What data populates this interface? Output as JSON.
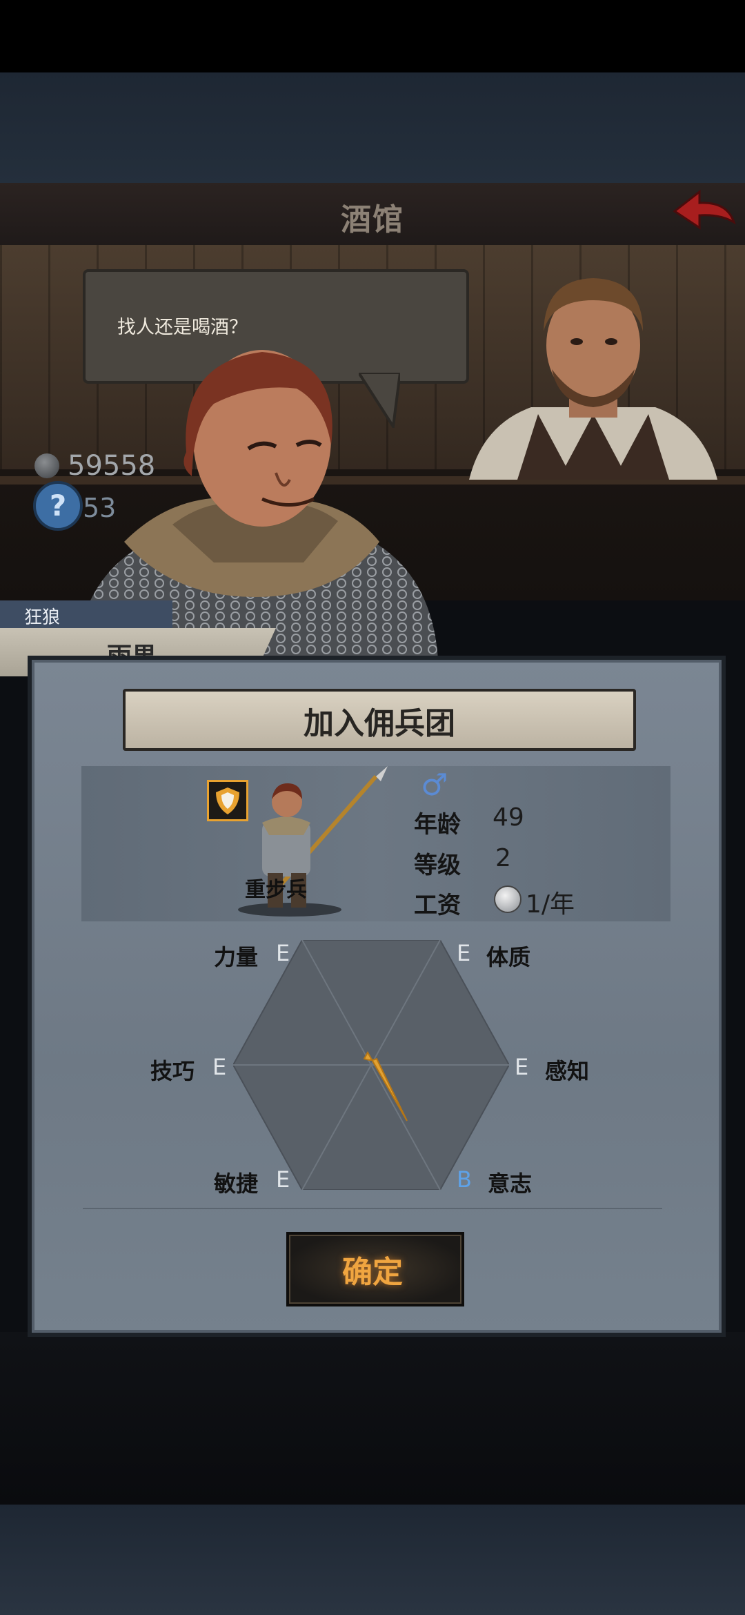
{
  "header": {
    "title": "酒馆"
  },
  "dialog": {
    "speech": "找人还是喝酒？"
  },
  "resources": {
    "coins": "59558",
    "unknown_count": "53",
    "help_symbol": "?"
  },
  "mercenary": {
    "tag": "狂狼",
    "name": "雨果"
  },
  "panel": {
    "title": "加入佣兵团",
    "unit_class": "重步兵",
    "gender_symbol": "♂",
    "stats": [
      {
        "label": "年龄",
        "value": "49"
      },
      {
        "label": "等级",
        "value": "2"
      },
      {
        "label": "工资",
        "value": "1/年"
      }
    ]
  },
  "attributes": [
    {
      "name": "力量",
      "grade": "E"
    },
    {
      "name": "体质",
      "grade": "E"
    },
    {
      "name": "技巧",
      "grade": "E"
    },
    {
      "name": "感知",
      "grade": "E"
    },
    {
      "name": "敏捷",
      "grade": "E"
    },
    {
      "name": "意志",
      "grade": "B"
    }
  ],
  "confirm": {
    "label": "确定"
  },
  "colors": {
    "accent": "#f0a540",
    "good_grade": "#5ea2e8",
    "badge_border": "#e8a230"
  },
  "icons": [
    "back-arrow-icon",
    "coin-icon",
    "help-icon",
    "shield-icon",
    "male-icon",
    "silver-coin-icon"
  ]
}
